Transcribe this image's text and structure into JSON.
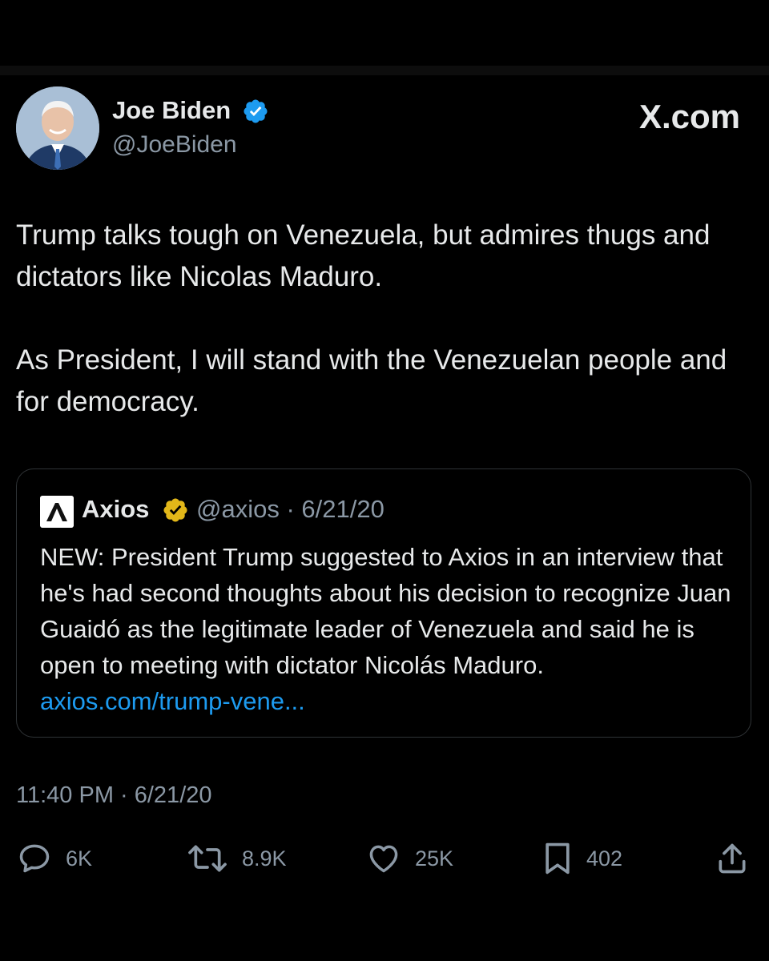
{
  "brand": {
    "text": "X.com"
  },
  "author": {
    "name": "Joe Biden",
    "handle": "@JoeBiden",
    "verified_color": "#1d9bf0",
    "avatar_icon": "profile-photo"
  },
  "tweet": {
    "paragraph_1": "Trump talks tough on Venezuela, but admires thugs and dictators like Nicolas Maduro.",
    "paragraph_2": "As President, I will stand with the Venezuelan people and for democracy."
  },
  "quote": {
    "logo_icon": "axios-logo",
    "name": "Axios",
    "verified_color": "#f5c518",
    "handle": "@axios",
    "separator": "·",
    "date": "6/21/20",
    "text": "NEW: President Trump suggested to Axios in an interview that he's had second thoughts about his decision to recognize Juan Guaidó as the legitimate leader of Venezuela and said he is open to meeting with dictator Nicolás Maduro.",
    "link_text": "axios.com/trump-vene...",
    "link_color": "#1d9bf0"
  },
  "timestamp": "11:40 PM · 6/21/20",
  "actions": {
    "reply": {
      "icon": "reply-icon",
      "count": "6K"
    },
    "retweet": {
      "icon": "retweet-icon",
      "count": "8.9K"
    },
    "like": {
      "icon": "heart-icon",
      "count": "25K"
    },
    "bookmark": {
      "icon": "bookmark-icon",
      "count": "402"
    },
    "share": {
      "icon": "share-icon"
    }
  }
}
